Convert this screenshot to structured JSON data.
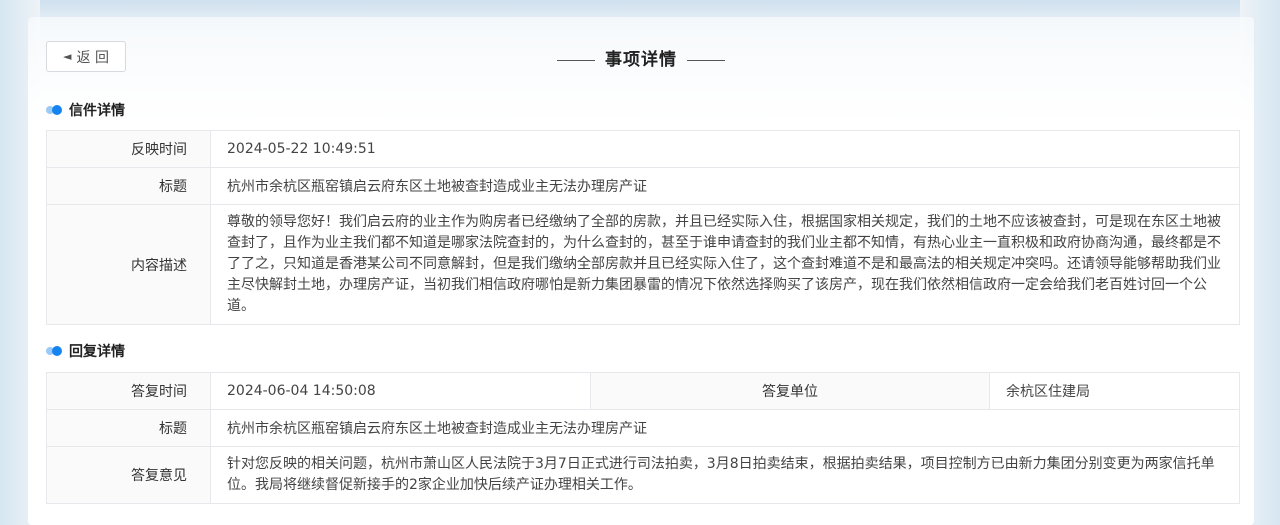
{
  "header": {
    "back_label": "返 回",
    "title": "事项详情"
  },
  "letter": {
    "section_title": "信件详情",
    "rows": [
      {
        "label": "反映时间",
        "value": "2024-05-22 10:49:51"
      },
      {
        "label": "标题",
        "value": "杭州市余杭区瓶窑镇启云府东区土地被查封造成业主无法办理房产证"
      },
      {
        "label": "内容描述",
        "value": "尊敬的领导您好！我们启云府的业主作为购房者已经缴纳了全部的房款，并且已经实际入住，根据国家相关规定，我们的土地不应该被查封，可是现在东区土地被查封了，且作为业主我们都不知道是哪家法院查封的，为什么查封的，甚至于谁申请查封的我们业主都不知情，有热心业主一直积极和政府协商沟通，最终都是不了了之，只知道是香港某公司不同意解封，但是我们缴纳全部房款并且已经实际入住了，这个查封难道不是和最高法的相关规定冲突吗。还请领导能够帮助我们业主尽快解封土地，办理房产证，当初我们相信政府哪怕是新力集团暴雷的情况下依然选择购买了该房产，现在我们依然相信政府一定会给我们老百姓讨回一个公道。"
      }
    ]
  },
  "reply": {
    "section_title": "回复详情",
    "time_label": "答复时间",
    "time_value": "2024-06-04 14:50:08",
    "unit_label": "答复单位",
    "unit_value": "余杭区住建局",
    "title_label": "标题",
    "title_value": "杭州市余杭区瓶窑镇启云府东区土地被查封造成业主无法办理房产证",
    "opinion_label": "答复意见",
    "opinion_value": "针对您反映的相关问题，杭州市萧山区人民法院于3月7日正式进行司法拍卖，3月8日拍卖结束，根据拍卖结果，项目控制方已由新力集团分别变更为两家信托单位。我局将继续督促新接手的2家企业加快后续产证办理相关工作。"
  },
  "icons": {
    "back": "back-arrow-icon",
    "section_marker": "blue-dots-icon"
  },
  "colors": {
    "accent": "#1684f0",
    "accent_light": "#9cc9f5"
  }
}
